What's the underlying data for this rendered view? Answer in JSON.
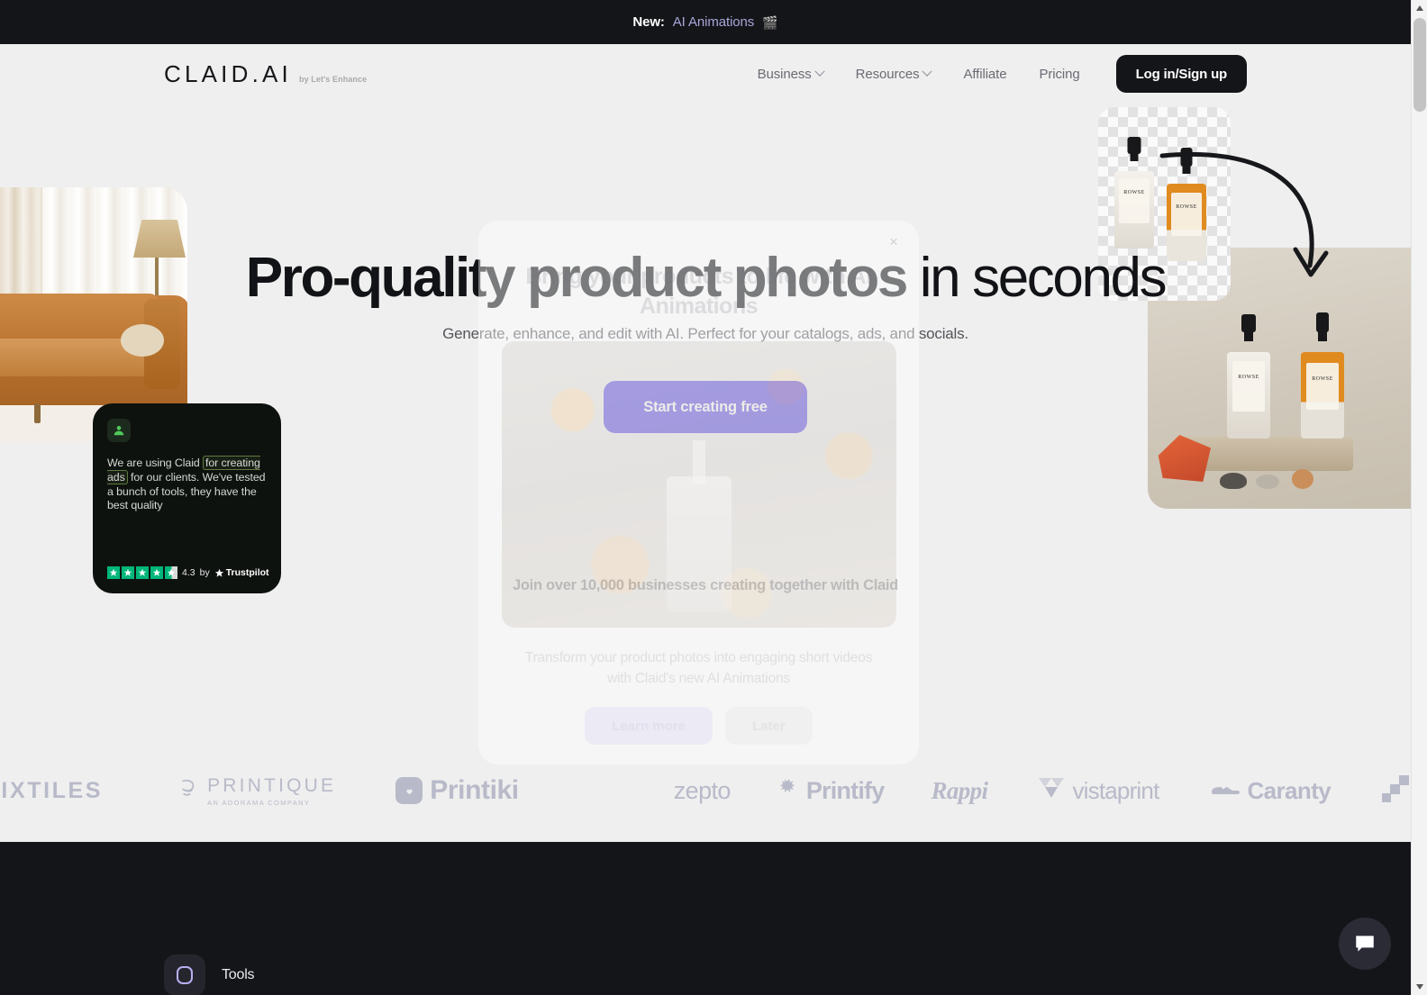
{
  "announcement": {
    "prefix": "New:",
    "link_label": "AI Animations",
    "emoji": "🎬"
  },
  "header": {
    "logo": "CLAID.AI",
    "logo_sub": "by Let's Enhance",
    "nav": [
      {
        "label": "Business",
        "has_dropdown": true
      },
      {
        "label": "Resources",
        "has_dropdown": true
      },
      {
        "label": "Affiliate",
        "has_dropdown": false
      },
      {
        "label": "Pricing",
        "has_dropdown": false
      }
    ],
    "login_label": "Log in/Sign up"
  },
  "hero": {
    "title_bold": "Pro-quality product photos",
    "title_light": " in seconds",
    "subtitle": "Generate, enhance, and edit with AI. Perfect for your catalogs, ads, and socials.",
    "cta_label": "Start creating free",
    "join_text": "Join over 10,000 businesses creating together with Claid"
  },
  "testimonial": {
    "text_before": "We are using Claid ",
    "highlight": "for creating ads",
    "text_after": " for our clients. We've tested a bunch of tools, they have the best quality",
    "score": "4.3",
    "by_label": "by",
    "source": "Trustpilot",
    "stars_filled": 4,
    "stars_total": 5,
    "star_color": "#00b67a"
  },
  "logos": [
    {
      "name": "MIXTILES"
    },
    {
      "name": "PRINTIQUE",
      "sub": "AN ADORAMA COMPANY"
    },
    {
      "name": "Printiki"
    },
    {
      "name": "zepto"
    },
    {
      "name": "Printify"
    },
    {
      "name": "Rappi"
    },
    {
      "name": "vistaprint"
    },
    {
      "name": "Caranty"
    }
  ],
  "modal": {
    "title": "Bring your products to life with AI Animations",
    "description": "Transform your product photos into engaging short videos with Claid's new AI Animations",
    "primary_label": "Learn more",
    "secondary_label": "Later",
    "close_label": "×"
  },
  "footer": {
    "tools_label": "Tools"
  },
  "colors": {
    "accent_purple": "#5b4be8",
    "dark": "#141519",
    "page_bg": "#efefef",
    "trustpilot_green": "#00b67a"
  }
}
